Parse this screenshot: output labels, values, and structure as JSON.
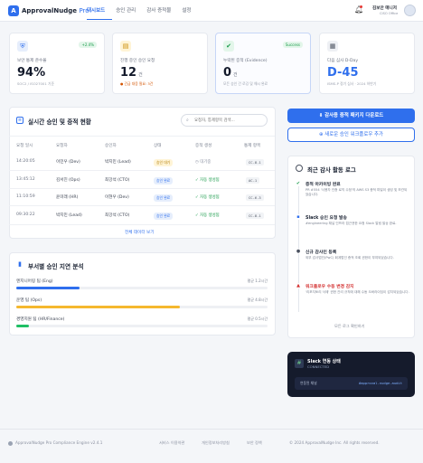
{
  "header": {
    "logo_glyph": "A",
    "brand_name": "ApprovalNudge",
    "brand_suffix": "Pro",
    "nav": [
      "대시보드",
      "승인 관리",
      "감사 증적물",
      "설정"
    ],
    "active_nav": 0,
    "user_name": "김보안 매니저",
    "user_role": "CISO Office",
    "icons": {
      "bell": "bell-icon",
      "avatar": "user-avatar"
    }
  },
  "kpis": [
    {
      "label": "보안 통제 준수율",
      "value": "94%",
      "unit": "",
      "sub": "SOC2 / ISO27001 기준",
      "badge": "+2.4%",
      "icon": "shield-icon",
      "glyph": "⛨",
      "icon_bg": "#e6eefc",
      "icon_color": "#2f6fed",
      "badge_bg": "#e3f6ea",
      "badge_color": "#1a9b4b"
    },
    {
      "label": "진행 중인 승인 요청",
      "value": "12",
      "unit": "건",
      "sub": "● 긴급 대응 필요: 3건",
      "badge": "",
      "icon": "clipboard-icon",
      "glyph": "▤",
      "icon_bg": "#fff4d6",
      "icon_color": "#c98a00",
      "badge_bg": "",
      "badge_color": ""
    },
    {
      "label": "누락된 증적 (Evidence)",
      "value": "0",
      "unit": "건",
      "sub": "모든 승인 건 로깅 및 해시 완료",
      "badge": "Success",
      "icon": "check-circle-icon",
      "glyph": "✔",
      "icon_bg": "#e3f6ea",
      "icon_color": "#1a9b4b",
      "badge_bg": "#e3f6ea",
      "badge_color": "#1a9b4b"
    },
    {
      "label": "다음 심사 D-Day",
      "value": "D-45",
      "unit": "",
      "sub": "ISMS-P 정기 심사 · 2024 하반기",
      "badge": "",
      "icon": "calendar-icon",
      "glyph": "▦",
      "icon_bg": "#eef0f4",
      "icon_color": "#4b5260",
      "badge_bg": "",
      "badge_color": ""
    }
  ],
  "approvals": {
    "title": "실시간 승인 및 증적 현황",
    "search_placeholder": "요청자, 통제항목 검색...",
    "columns": [
      "요청 일시",
      "요청자",
      "승인자",
      "상태",
      "증적 생성",
      "통제 항목"
    ],
    "rows": [
      {
        "time": "14:20:05",
        "requester": "이민우 (Dev)",
        "approver": "박지민 (Lead)",
        "status": "승인 대기",
        "status_kind": "pending",
        "evidence": "◷ 대기중",
        "evidence_kind": "wait",
        "control": "CC-8.1"
      },
      {
        "time": "13:45:12",
        "requester": "김서진 (Ops)",
        "approver": "최강석 (CTO)",
        "status": "승인 완료",
        "status_kind": "done",
        "evidence": "✓ 자동 생성됨",
        "evidence_kind": "ok",
        "control": "AC-1"
      },
      {
        "time": "11:10:59",
        "requester": "윤미래 (HR)",
        "approver": "이현우 (Dev)",
        "status": "승인 완료",
        "status_kind": "done",
        "evidence": "✓ 자동 생성됨",
        "evidence_kind": "ok",
        "control": "CC-6.3"
      },
      {
        "time": "09:30:22",
        "requester": "박지민 (Lead)",
        "approver": "최강석 (CTO)",
        "status": "승인 완료",
        "status_kind": "done",
        "evidence": "✓ 자동 생성됨",
        "evidence_kind": "ok",
        "control": "CC-8.1"
      }
    ],
    "more_link": "전체 데이터 보기"
  },
  "delays": {
    "title": "부서별 승인 지연 분석",
    "items": [
      {
        "name": "엔지니어링 팀 (Eng)",
        "value": "평균 1.2시간",
        "fraction": 0.25,
        "color": "#2f6fed"
      },
      {
        "name": "운영 팀 (Ops)",
        "value": "평균 4.8시간",
        "fraction": 0.65,
        "color": "#f5b82e"
      },
      {
        "name": "경영지원 팀 (HR/Finance)",
        "value": "평균 0.5시간",
        "fraction": 0.05,
        "color": "#1fbf64"
      }
    ]
  },
  "actions": {
    "primary": "⬇ 감사용 증적 패키지 다운로드",
    "secondary": "⊕ 새로운 승인 워크플로우 추가"
  },
  "log": {
    "title": "최근 감사 활동 로그",
    "entries": [
      {
        "head": "증적 아카이빙 완료",
        "body": "PR #554 '사용자 인증 로직 수정'의 AWS S3 증적 파일이 생성 및 보관되었습니다.",
        "kind": "ok",
        "icon": "check-icon"
      },
      {
        "head": "Slack 승인 요청 발송",
        "body": "#engineering 채널 인프라 접근권한 요청 Slack 알림 발송 완료.",
        "kind": "info",
        "icon": "message-icon"
      },
      {
        "head": "신규 감사인 등록",
        "body": "외부 감사법인(PwC) 회계법인 증적 조회 권한이 부여되었습니다.",
        "kind": "user",
        "icon": "user-icon"
      },
      {
        "head": "워크플로우 수동 변경 감지",
        "body": "'리포지토리 삭제' 권한 관리 규칙에 대해 수동 오버라이딩이 감지되었습니다.",
        "kind": "alert",
        "icon": "warning-icon"
      }
    ],
    "more": "모든 로그 확인하기"
  },
  "slack": {
    "title": "Slack 연동 상태",
    "status": "CONNECTED",
    "key": "연동된 채널",
    "value": "#approval-nudge-audit",
    "icon": "slack-icon"
  },
  "footer": {
    "left": "ApprovalNudge Pro Compliance Engine v2.4.1",
    "links": [
      "서비스 이용약관",
      "개인정보처리방침",
      "보안 정책"
    ],
    "copyright": "© 2024 ApprovalNudge Inc. All rights reserved."
  }
}
